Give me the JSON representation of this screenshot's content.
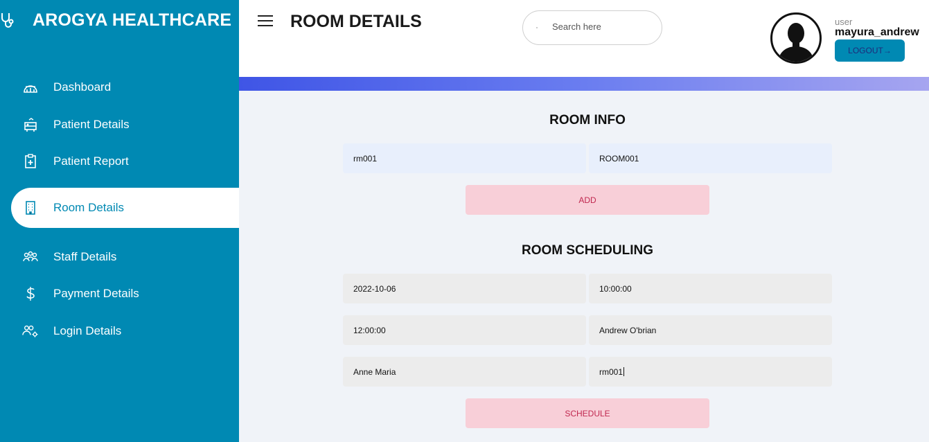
{
  "brand": {
    "title": "AROGYA HEALTHCARE",
    "icon": "stethoscope-icon"
  },
  "sidebar": {
    "items": [
      {
        "label": "Dashboard",
        "icon": "dashboard-icon",
        "active": false
      },
      {
        "label": "Patient Details",
        "icon": "bed-icon",
        "active": false
      },
      {
        "label": "Patient Report",
        "icon": "clipboard-plus-icon",
        "active": false
      },
      {
        "label": "Room Details",
        "icon": "building-icon",
        "active": true
      },
      {
        "label": "Staff Details",
        "icon": "staff-icon",
        "active": false
      },
      {
        "label": "Payment Details",
        "icon": "dollar-icon",
        "active": false
      },
      {
        "label": "Login Details",
        "icon": "users-gear-icon",
        "active": false
      }
    ]
  },
  "header": {
    "title": "ROOM DETAILS",
    "search_placeholder": "Search here",
    "user_role": "user",
    "user_name": "mayura_andrew",
    "logout_label": "LOGOUT→"
  },
  "room_info": {
    "title": "ROOM INFO",
    "room_id": "rm001",
    "room_name": "ROOM001",
    "add_label": "ADD"
  },
  "room_scheduling": {
    "title": "ROOM SCHEDULING",
    "date": "2022-10-06",
    "start_time": "10:00:00",
    "end_time": "12:00:00",
    "doctor": "Andrew O'brian",
    "patient": "Anne Maria",
    "room_id": "rm001",
    "schedule_label": "SCHEDULE"
  },
  "colors": {
    "sidebar": "#0089b3",
    "accent_pink": "#f8cfd8",
    "pink_text": "#c0284f",
    "field_blue": "#e8effc",
    "field_grey": "#ececec"
  }
}
